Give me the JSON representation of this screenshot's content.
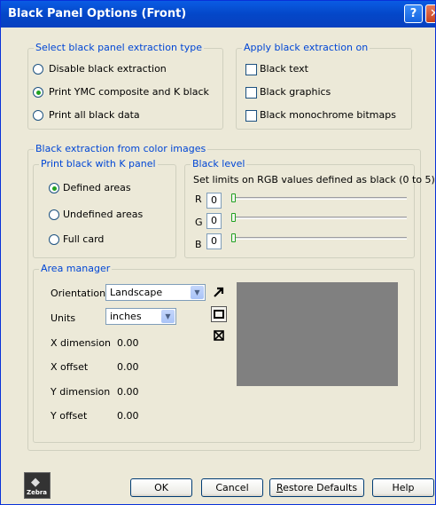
{
  "window": {
    "title": "Black Panel Options (Front)",
    "help_glyph": "?",
    "close_glyph": "✕"
  },
  "extraction_type": {
    "legend": "Select black panel extraction type",
    "options": [
      "Disable black extraction",
      "Print YMC composite and K black",
      "Print all black data"
    ],
    "selected_index": 1
  },
  "apply_on": {
    "legend": "Apply black extraction on",
    "options": [
      {
        "label": "Black text",
        "checked": false
      },
      {
        "label": "Black graphics",
        "checked": false
      },
      {
        "label": "Black monochrome bitmaps",
        "checked": false
      }
    ]
  },
  "color_images": {
    "legend": "Black extraction from color images",
    "k_panel": {
      "legend": "Print black with K panel",
      "options": [
        "Defined areas",
        "Undefined areas",
        "Full card"
      ],
      "selected_index": 0
    },
    "black_level": {
      "legend": "Black level",
      "description": "Set limits on RGB values defined as black (0 to 5):",
      "channels": [
        {
          "label": "R",
          "value": "0"
        },
        {
          "label": "G",
          "value": "0"
        },
        {
          "label": "B",
          "value": "0"
        }
      ]
    }
  },
  "area_manager": {
    "legend": "Area manager",
    "orientation": {
      "label": "Orientation",
      "value": "Landscape"
    },
    "units": {
      "label": "Units",
      "value": "inches"
    },
    "fields": [
      {
        "label": "X dimension",
        "value": "0.00"
      },
      {
        "label": "X offset",
        "value": "0.00"
      },
      {
        "label": "Y dimension",
        "value": "0.00"
      },
      {
        "label": "Y offset",
        "value": "0.00"
      }
    ],
    "tools": [
      "pointer-icon",
      "rectangle-icon",
      "delete-area-icon"
    ],
    "preview_color": "#808080"
  },
  "buttons": {
    "ok": "OK",
    "cancel": "Cancel",
    "restore_first": "R",
    "restore_rest": "estore Defaults",
    "help": "Help"
  },
  "logo": {
    "text": "Zebra"
  }
}
